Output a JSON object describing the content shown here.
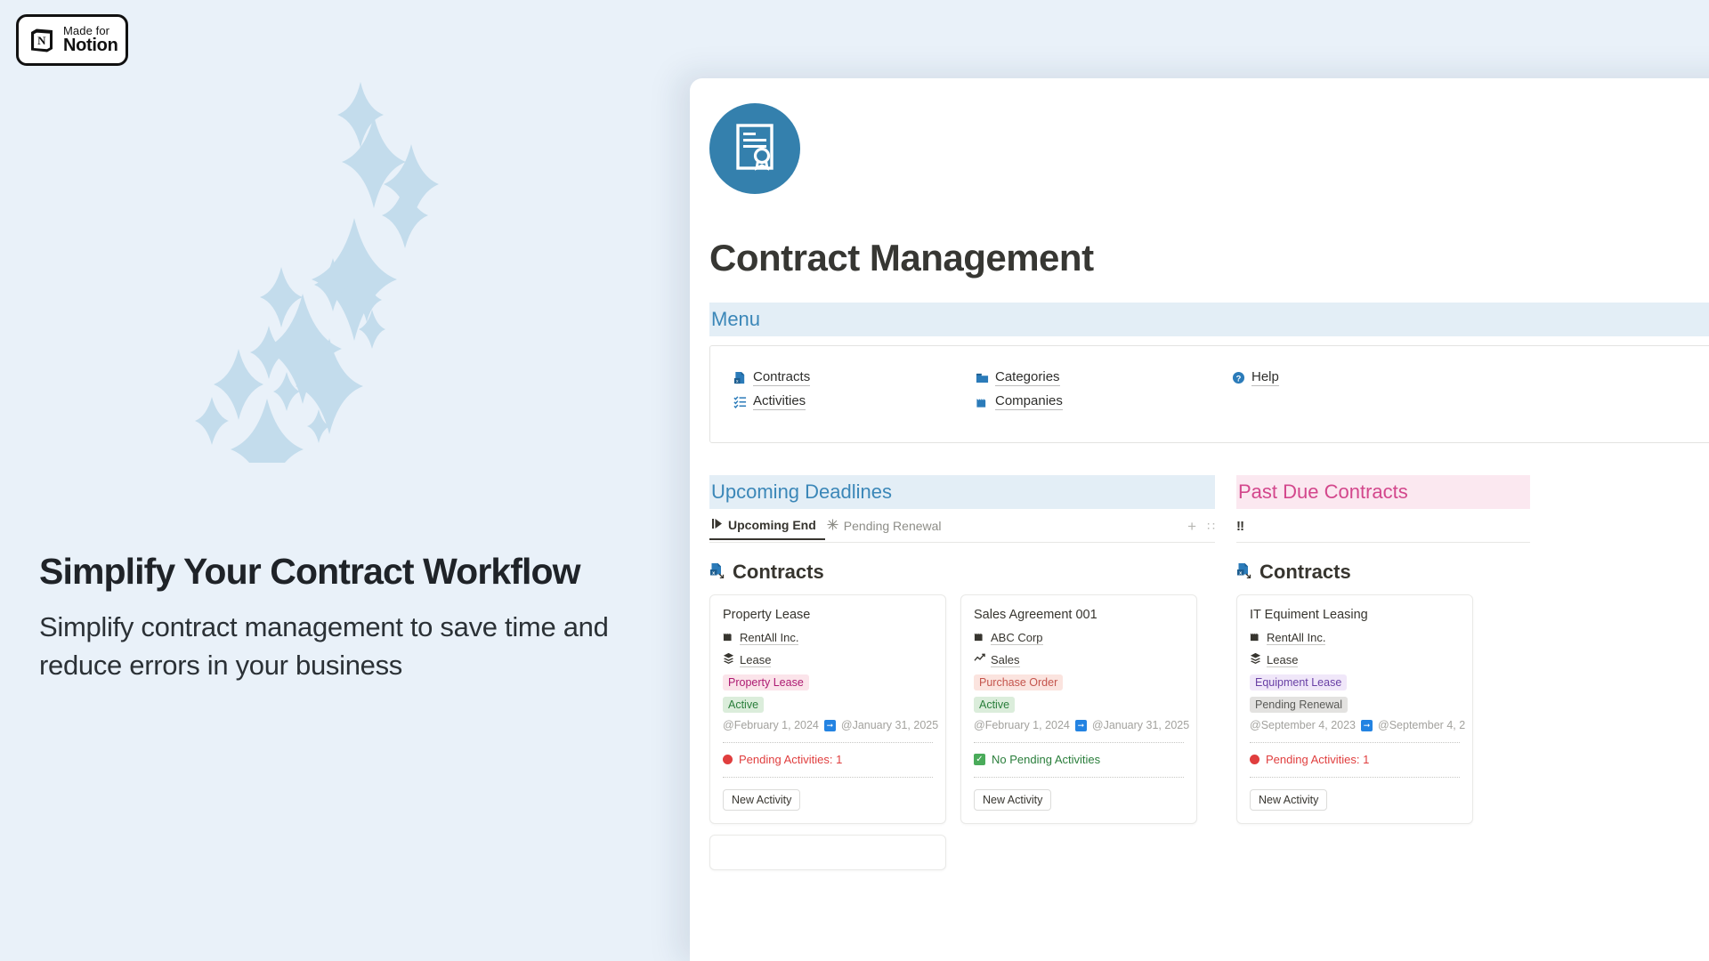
{
  "badge": {
    "made_for": "Made for",
    "product": "Notion",
    "icon": "notion-cube-icon"
  },
  "promo": {
    "headline": "Simplify Your Contract Workflow",
    "subtext": "Simplify contract management to save time and reduce errors in your business"
  },
  "app": {
    "icon": "certificate-document-icon",
    "title": "Contract Management",
    "accent_blue": "#3480ad",
    "menu": {
      "heading": "Menu",
      "items": [
        {
          "label": "Contracts",
          "icon": "document-export-icon"
        },
        {
          "label": "Categories",
          "icon": "folder-icon"
        },
        {
          "label": "Help",
          "icon": "question-circle-icon"
        },
        {
          "label": "Activities",
          "icon": "checklist-icon"
        },
        {
          "label": "Companies",
          "icon": "company-building-icon"
        }
      ]
    },
    "sections": [
      {
        "heading": "Upcoming Deadlines",
        "heading_color": "#3b87b8",
        "tabs": [
          {
            "label": "Upcoming End",
            "icon": "play-marker-icon",
            "active": true
          },
          {
            "label": "Pending Renewal",
            "icon": "snowflake-icon",
            "active": false
          }
        ],
        "tools": [
          {
            "name": "add-view-button",
            "glyph": "+"
          },
          {
            "name": "drag-handle-icon",
            "glyph": "∷"
          }
        ],
        "database_title": "Contracts",
        "database_icon": "database-export-icon",
        "cards": [
          {
            "title": "Property Lease",
            "company": "RentAll Inc.",
            "company_icon": "company-building-icon",
            "category": "Lease",
            "category_icon": "stack-icon",
            "type_chip": "Property Lease",
            "type_chip_color": "pink",
            "status_chip": "Active",
            "status_chip_color": "green",
            "start_date": "@February 1, 2024",
            "end_date": "@January 31, 2025",
            "activity_status": "Pending Activities: 1",
            "activity_state": "red",
            "action": "New Activity"
          },
          {
            "title": "Sales Agreement 001",
            "company": "ABC Corp",
            "company_icon": "company-building-icon",
            "category": "Sales",
            "category_icon": "line-chart-icon",
            "type_chip": "Purchase Order",
            "type_chip_color": "red",
            "status_chip": "Active",
            "status_chip_color": "green",
            "start_date": "@February 1, 2024",
            "end_date": "@January 31, 2025",
            "activity_status": "No Pending Activities",
            "activity_state": "green",
            "action": "New Activity"
          }
        ]
      },
      {
        "heading": "Past Due Contracts",
        "heading_color": "#d3478c",
        "tabs": [
          {
            "label": "",
            "icon": "double-exclamation-icon",
            "active": false
          }
        ],
        "tools": [
          {
            "name": "drag-handle-icon",
            "glyph": "∷"
          }
        ],
        "database_title": "Contracts",
        "database_icon": "database-export-icon",
        "cards": [
          {
            "title": "IT Equiment Leasing",
            "company": "RentAll Inc.",
            "company_icon": "company-building-icon",
            "category": "Lease",
            "category_icon": "stack-icon",
            "type_chip": "Equipment Lease",
            "type_chip_color": "purple",
            "status_chip": "Pending Renewal",
            "status_chip_color": "gray",
            "start_date": "@September 4, 2023",
            "end_date": "@September 4, 2",
            "activity_status": "Pending Activities: 1",
            "activity_state": "red",
            "action": "New Activity"
          }
        ]
      }
    ]
  }
}
